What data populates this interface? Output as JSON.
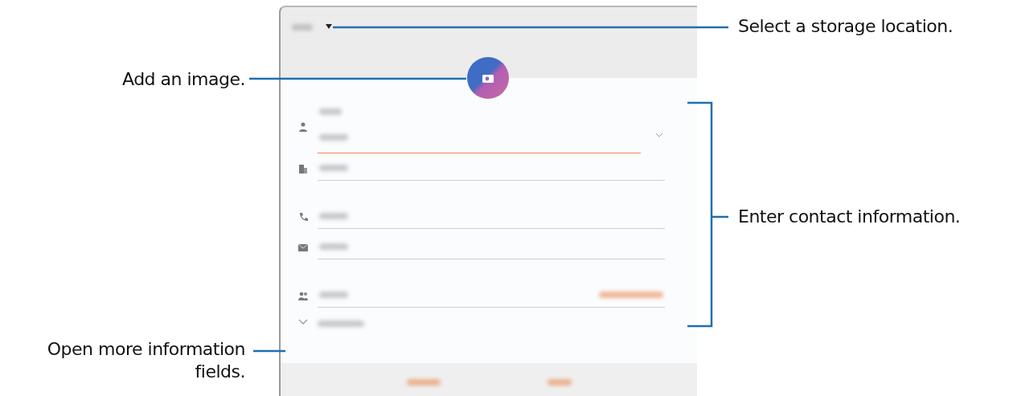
{
  "callouts": [
    {
      "text": "Select a storage location."
    },
    {
      "text": "Add an image."
    },
    {
      "text": "Enter contact information."
    },
    {
      "text": "Open more information fields."
    }
  ],
  "form": {
    "fields": [
      {
        "kind": "name",
        "focused": true
      },
      {
        "kind": "organization",
        "focused": false
      },
      {
        "kind": "phone",
        "focused": false
      },
      {
        "kind": "email",
        "focused": false
      },
      {
        "kind": "groups",
        "focused": false
      }
    ]
  }
}
